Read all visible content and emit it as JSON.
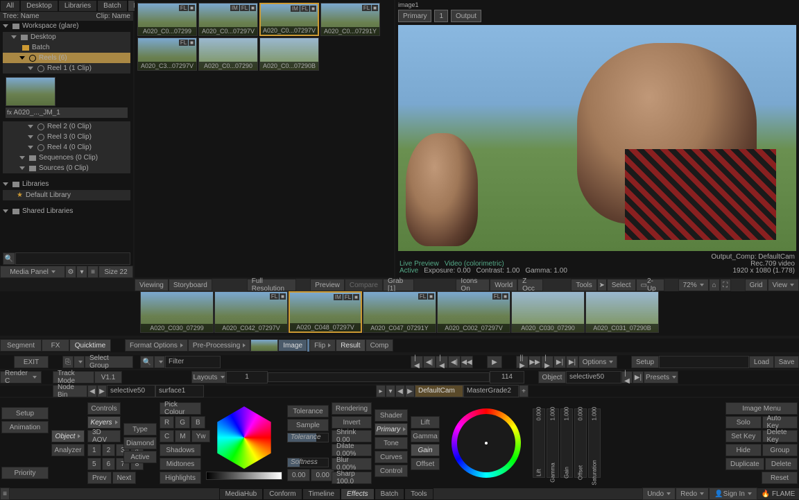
{
  "topTabs": [
    "All",
    "Desktop",
    "Libraries",
    "Batch",
    "FX"
  ],
  "topTabActive": 4,
  "treeHeader": {
    "left": "Tree: Name",
    "right": "Clip: Name"
  },
  "workspace": "Workspace (glare)",
  "tree": {
    "desktop": "Desktop",
    "batch": "Batch",
    "reels": "Reels (6)",
    "reel1": "Reel 1 (1 Clip)",
    "clip": "A020_..._JM_1",
    "reel2": "Reel 2 (0 Clip)",
    "reel3": "Reel 3 (0 Clip)",
    "reel4": "Reel 4 (0 Clip)",
    "sequences": "Sequences (0 Clip)",
    "sources": "Sources (0 Clip)",
    "libraries": "Libraries",
    "defaultLib": "Default Library",
    "shared": "Shared Libraries"
  },
  "thumbs": [
    "A020_C0...07299",
    "A020_C0...07297V",
    "A020_C0...07297V",
    "A020_C0...07291Y",
    "A020_C3...07297V",
    "A020_C0...07290",
    "A020_C0...07290B"
  ],
  "thumbSelIndex": 2,
  "viewer": {
    "title": "image1",
    "tabs": [
      "Primary",
      "1",
      "Output"
    ],
    "meta1": "Output_Comp: DefaultCam",
    "meta2": "Rec.709 video",
    "meta3": "1920 x 1080 (1.778)",
    "status1": "Live Preview",
    "status2": "Video (colorimetric)",
    "status3": "Active",
    "exp": "Exposure: 0.00",
    "con": "Contrast: 1.00",
    "gam": "Gamma: 1.00"
  },
  "mediaBar": {
    "panel": "Media Panel",
    "size": "Size 22"
  },
  "viewBar": {
    "viewing": "Viewing",
    "storyboard": "Storyboard",
    "fullres": "Full Resolution",
    "preview": "Preview",
    "compare": "Compare",
    "grab": "Grab [1]",
    "icons": "Icons On",
    "world": "World",
    "zocc": "Z Occ",
    "tools": "Tools",
    "select": "Select",
    "twoup": "2-Up",
    "zoom": "72%",
    "grid": "Grid",
    "view": "View"
  },
  "storyThumbs": [
    "A020_C030_07299",
    "A020_C042_07297V",
    "A020_C048_07297V",
    "A020_C047_07291Y",
    "A020_C002_07297V",
    "A020_C030_07290",
    "A020_C031_07290B"
  ],
  "storySelIndex": 2,
  "effectTabs": {
    "segment": "Segment",
    "fx": "FX",
    "quicktime": "Quicktime",
    "format": "Format Options",
    "prepro": "Pre-Processing",
    "image": "Image",
    "flip": "Flip",
    "result": "Result",
    "comp": "Comp"
  },
  "controls": {
    "exit": "EXIT",
    "selectGroup": "Select Group",
    "filter": "Filter",
    "options": "Options",
    "setup": "Setup",
    "load": "Load",
    "save": "Save",
    "renderC": "Render C",
    "trackMode": "Track Mode",
    "v11": "V1.1",
    "layouts": "Layouts",
    "frameA": "1",
    "frameB": "114",
    "object": "Object",
    "selective": "selective50",
    "presets": "Presets",
    "nodeBin": "Node Bin",
    "surface": "surface1",
    "defaultCam": "DefaultCam",
    "masterGrade": "MasterGrade2",
    "setupBtn": "Setup",
    "objectBtn": "Object",
    "controlsBtn": "Controls",
    "type": "Type",
    "pickColour": "Pick Colour",
    "animation": "Animation",
    "analyzer": "Analyzer",
    "keyers": "Keyers",
    "diamond": "Diamond",
    "aov": "3D AOV",
    "active": "Active",
    "shadows": "Shadows",
    "midtones": "Midtones",
    "highlights": "Highlights",
    "prev": "Prev",
    "next": "Next",
    "priority": "Priority",
    "r": "R",
    "g": "G",
    "b": "B",
    "c": "C",
    "m": "M",
    "yw": "Yw",
    "n1": "1",
    "n2": "2",
    "n3": "3",
    "n4": "4",
    "n5": "5",
    "n6": "6",
    "n7": "7",
    "n8": "8",
    "tolerance": "Tolerance",
    "sample": "Sample",
    "softness": "Softness",
    "zeroA": "0.00",
    "zeroB": "0.00",
    "zeroC": "0.00",
    "zeroD": "0.00",
    "rendering": "Rendering",
    "invert": "Invert",
    "shrink": "Shrink 0.00",
    "dilate": "Dilate 0.00%",
    "blur": "Blur 0.00%",
    "sharp": "Sharp 100.0",
    "shader": "Shader",
    "primary": "Primary",
    "tone": "Tone",
    "curves": "Curves",
    "control": "Control",
    "lift": "Lift",
    "gamma": "Gamma",
    "gain": "Gain",
    "offset": "Offset",
    "imageMenu": "Image Menu",
    "solo": "Solo",
    "autoKey": "Auto Key",
    "setKey": "Set Key",
    "deleteKey": "Delete Key",
    "hide": "Hide",
    "group": "Group",
    "duplicate": "Duplicate",
    "delete": "Delete",
    "reset": "Reset"
  },
  "vsliders": [
    {
      "label": "Lift",
      "val": "0.000"
    },
    {
      "label": "Gamma",
      "val": "1.000"
    },
    {
      "label": "Gain",
      "val": "1.000"
    },
    {
      "label": "Offset",
      "val": "0.000"
    },
    {
      "label": "Saturation",
      "val": "1.000"
    }
  ],
  "footer": {
    "mediahub": "MediaHub",
    "conform": "Conform",
    "timeline": "Timeline",
    "effects": "Effects",
    "batch": "Batch",
    "tools": "Tools",
    "undo": "Undo",
    "redo": "Redo",
    "signin": "Sign In",
    "brand": "FLAME"
  }
}
